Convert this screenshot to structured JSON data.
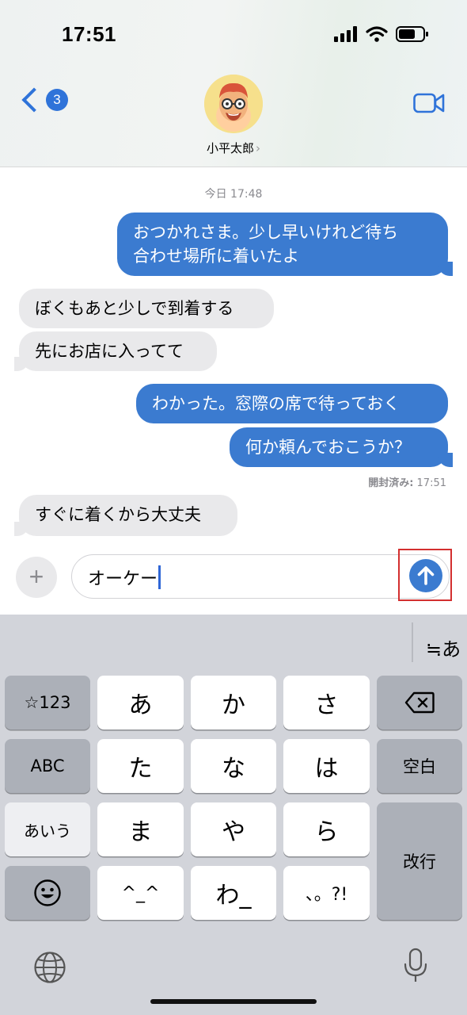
{
  "status_bar": {
    "time": "17:51"
  },
  "nav": {
    "back_badge": "3",
    "contact_name": "小平太郎",
    "contact_chevron": "›",
    "video_icon": "video-camera-icon"
  },
  "thread": {
    "timestamp": "今日 17:48",
    "messages": [
      {
        "from": "me",
        "text_line1": "おつかれさま。少し早いけれど待ち",
        "text_line2": "合わせ場所に着いたよ"
      },
      {
        "from": "them",
        "text": "ぼくもあと少しで到着する"
      },
      {
        "from": "them",
        "text": "先にお店に入ってて"
      },
      {
        "from": "me",
        "text": "わかった。窓際の席で待っておく"
      },
      {
        "from": "me",
        "text": "何か頼んでおこうか？"
      },
      {
        "from": "them",
        "text": "すぐに着くから大丈夫"
      }
    ],
    "read_receipt_label": "開封済み:",
    "read_receipt_time": "17:51"
  },
  "composer": {
    "plus_label": "+",
    "input_value": "オーケー",
    "send_icon": "arrow-up-icon",
    "send_highlighted": true,
    "highlight_color": "#d32f2f"
  },
  "keyboard": {
    "mode_label": "≒あ",
    "keys": {
      "num": "☆123",
      "abc": "ABC",
      "aiu": "あいう",
      "a": "あ",
      "ka": "か",
      "sa": "さ",
      "ta": "た",
      "na": "な",
      "ha": "は",
      "ma": "ま",
      "ya": "や",
      "ra": "ら",
      "kao": "^_^",
      "wa": "わ_",
      "punct": "、。?!",
      "space": "空白",
      "enter": "改行"
    },
    "icons": [
      "emoji-icon",
      "delete-icon",
      "globe-icon",
      "microphone-icon"
    ]
  },
  "colors": {
    "accent": "#3b7bd0",
    "incoming_bubble": "#e9e9eb",
    "keyboard_bg": "#d2d4da"
  }
}
